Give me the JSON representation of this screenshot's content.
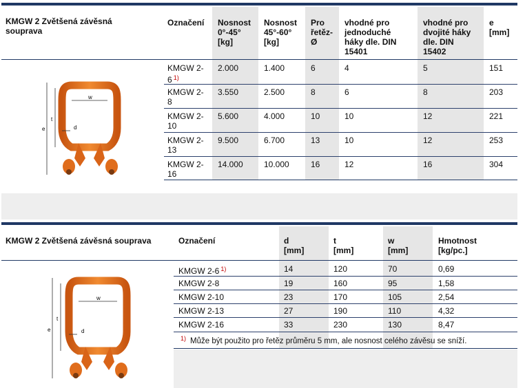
{
  "table1": {
    "title": "KMGW 2 Zvětšená závěsná\nsouprava",
    "headers": [
      "Označení",
      "Nosnost\n0°-45°\n[kg]",
      "Nosnost\n45°-60°\n[kg]",
      "Pro\nřetěz-\nØ",
      "vhodné pro\njednoduché\nháky dle. DIN\n15401",
      "vhodné pro\ndvojité háky\ndle. DIN\n15402",
      "e\n[mm]"
    ],
    "rows": [
      {
        "name": "KMGW 2-\n6",
        "note": "1)",
        "c1": "2.000",
        "c2": "1.400",
        "c3": "6",
        "c4": "4",
        "c5": "5",
        "c6": "151"
      },
      {
        "name": "KMGW 2-\n8",
        "note": "",
        "c1": "3.550",
        "c2": "2.500",
        "c3": "8",
        "c4": "6",
        "c5": "8",
        "c6": "203"
      },
      {
        "name": "KMGW 2-\n10",
        "note": "",
        "c1": "5.600",
        "c2": "4.000",
        "c3": "10",
        "c4": "10",
        "c5": "12",
        "c6": "221"
      },
      {
        "name": "KMGW 2-\n13",
        "note": "",
        "c1": "9.500",
        "c2": "6.700",
        "c3": "13",
        "c4": "10",
        "c5": "12",
        "c6": "253"
      },
      {
        "name": "KMGW 2-\n16",
        "note": "",
        "c1": "14.000",
        "c2": "10.000",
        "c3": "16",
        "c4": "12",
        "c5": "16",
        "c6": "304"
      }
    ]
  },
  "table2": {
    "title": "KMGW 2 Zvětšená závěsná souprava",
    "headers": [
      "Označení",
      "d\n[mm]",
      "t\n[mm]",
      "w\n[mm]",
      "Hmotnost\n[kg/pc.]"
    ],
    "rows": [
      {
        "name": "KMGW 2-6",
        "note": "1)",
        "d": "14",
        "t": "120",
        "w": "70",
        "m": "0,69"
      },
      {
        "name": "KMGW 2-8",
        "note": "",
        "d": "19",
        "t": "160",
        "w": "95",
        "m": "1,58"
      },
      {
        "name": "KMGW 2-10",
        "note": "",
        "d": "23",
        "t": "170",
        "w": "105",
        "m": "2,54"
      },
      {
        "name": "KMGW 2-13",
        "note": "",
        "d": "27",
        "t": "190",
        "w": "110",
        "m": "4,32"
      },
      {
        "name": "KMGW 2-16",
        "note": "",
        "d": "33",
        "t": "230",
        "w": "130",
        "m": "8,47"
      }
    ],
    "footnote_mark": "1)",
    "footnote": "Může být použito pro řetěz průměru 5 mm, ale nosnost celého závěsu se sníží."
  },
  "diagram_labels": {
    "w": "w",
    "t": "t",
    "e": "e",
    "d": "d"
  },
  "colors": {
    "accent": "#1f3864",
    "orange": "#e8701e",
    "shade": "#e6e6e6",
    "footnote_mark": "#c00000"
  }
}
